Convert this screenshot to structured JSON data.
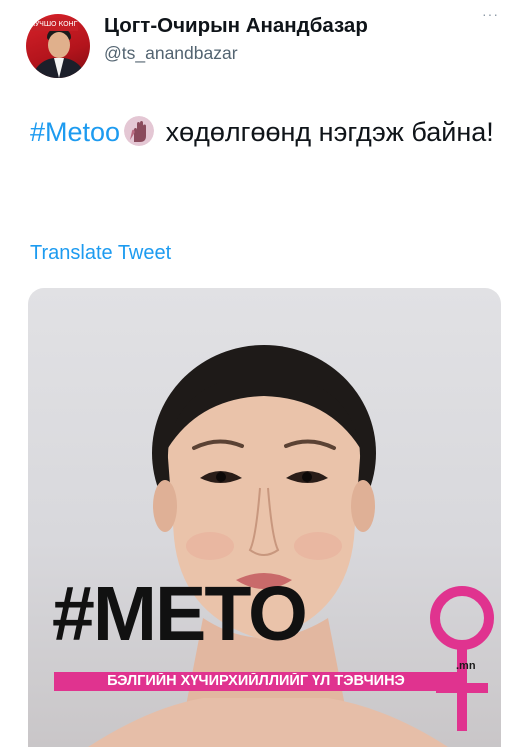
{
  "user": {
    "display_name": "Цогт-Очирын Анандбазар",
    "handle": "@ts_anandbazar",
    "avatar_banner_text": "ЛУЧШО КОНГЕЗ"
  },
  "more_menu": "···",
  "tweet": {
    "hashtag": "#Metoo",
    "emoji_icon": "raised-hand-emoji",
    "text_after_emoji": " хөдөлгөөнд нэгдэж байна!",
    "translate_link": "Translate Tweet"
  },
  "media": {
    "headline": "#METO",
    "domain_suffix": ".mn",
    "subtitle": "БЭЛГИЙН ХҮЧИРХИЙЛЛИЙГ ҮЛ ТЭВЧИНЭ",
    "accent_color": "#e0338f",
    "background_color": "#dcdcdf"
  },
  "colors": {
    "link": "#1d9bf0",
    "secondary_text": "#536471"
  }
}
